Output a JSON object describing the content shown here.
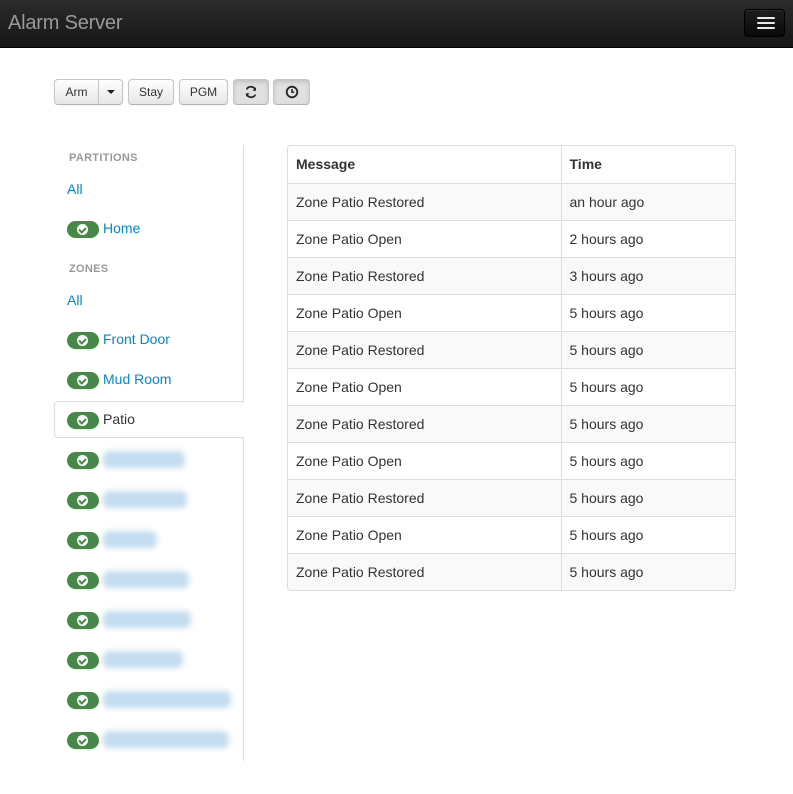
{
  "app": {
    "title": "Alarm Server"
  },
  "toolbar": {
    "arm_label": "Arm",
    "stay_label": "Stay",
    "pgm_label": "PGM"
  },
  "sidebar": {
    "partitions_header": "PARTITIONS",
    "partitions_all": "All",
    "partitions": [
      {
        "label": "Home",
        "status": "ok"
      }
    ],
    "zones_header": "ZONES",
    "zones_all": "All",
    "zones": [
      {
        "label": "Front Door",
        "status": "ok"
      },
      {
        "label": "Mud Room",
        "status": "ok"
      },
      {
        "label": "Patio",
        "status": "ok",
        "active": true
      },
      {
        "label": "",
        "status": "ok"
      },
      {
        "label": "",
        "status": "ok"
      },
      {
        "label": "",
        "status": "ok"
      },
      {
        "label": "",
        "status": "ok"
      },
      {
        "label": "",
        "status": "ok"
      },
      {
        "label": "",
        "status": "ok"
      },
      {
        "label": "",
        "status": "ok"
      },
      {
        "label": "",
        "status": "ok"
      }
    ]
  },
  "events_table": {
    "columns": [
      "Message",
      "Time"
    ],
    "rows": [
      [
        "Zone Patio Restored",
        "an hour ago"
      ],
      [
        "Zone Patio Open",
        "2 hours ago"
      ],
      [
        "Zone Patio Restored",
        "3 hours ago"
      ],
      [
        "Zone Patio Open",
        "5 hours ago"
      ],
      [
        "Zone Patio Restored",
        "5 hours ago"
      ],
      [
        "Zone Patio Open",
        "5 hours ago"
      ],
      [
        "Zone Patio Restored",
        "5 hours ago"
      ],
      [
        "Zone Patio Open",
        "5 hours ago"
      ],
      [
        "Zone Patio Restored",
        "5 hours ago"
      ],
      [
        "Zone Patio Open",
        "5 hours ago"
      ],
      [
        "Zone Patio Restored",
        "5 hours ago"
      ]
    ]
  },
  "colors": {
    "status_ok": "#468847",
    "link": "#0088cc"
  }
}
